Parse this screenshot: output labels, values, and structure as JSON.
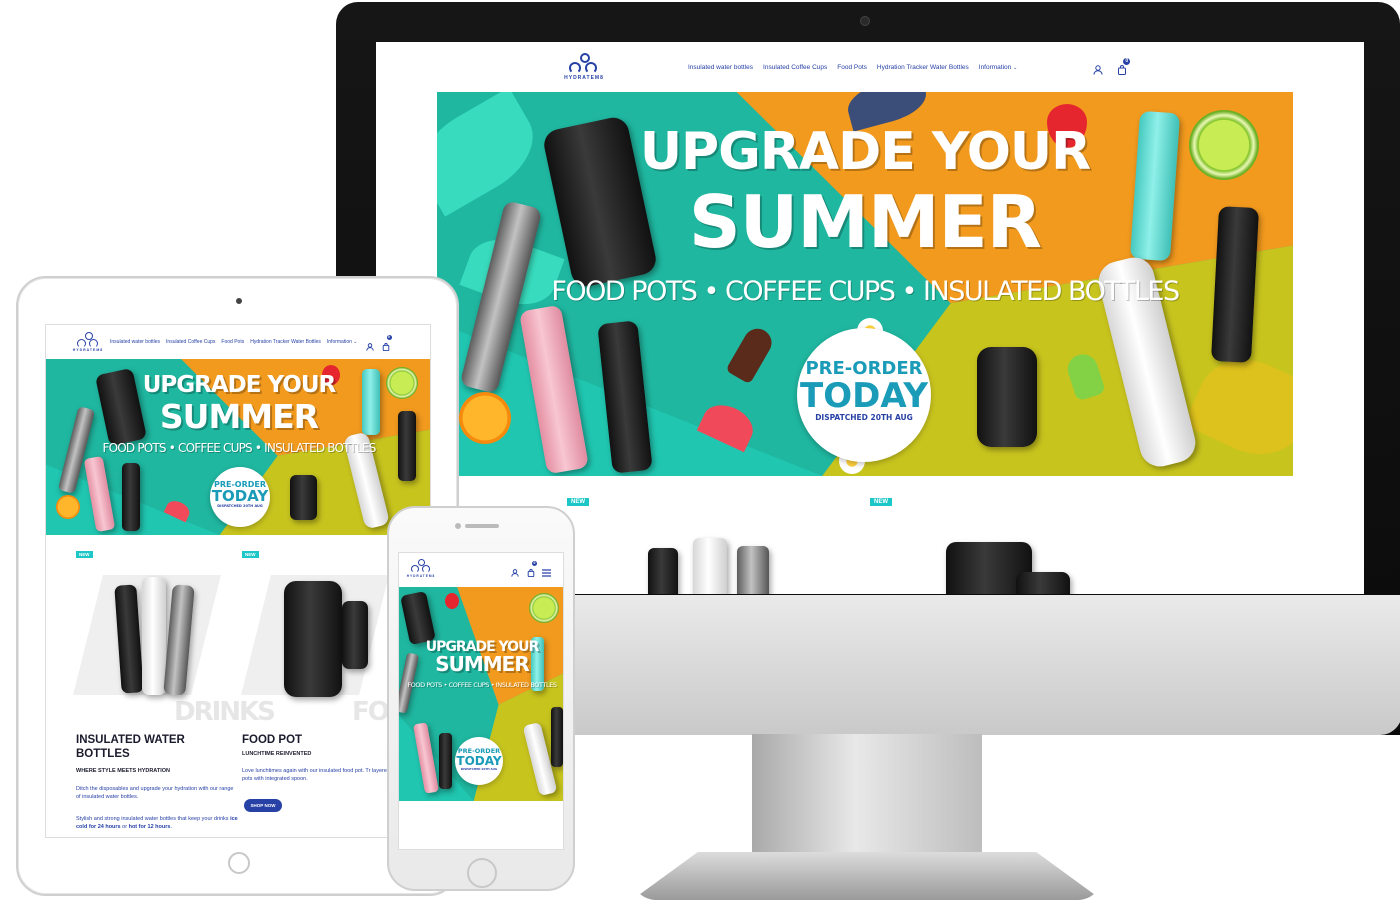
{
  "brand": {
    "logo_text": "HYDRATEM8",
    "primary_color": "#2741a6",
    "accent_color": "#1ec7c7"
  },
  "nav": {
    "items": [
      {
        "label": "Insulated water bottles"
      },
      {
        "label": "Insulated Coffee Cups"
      },
      {
        "label": "Food Pots"
      },
      {
        "label": "Hydration Tracker Water Bottles"
      },
      {
        "label": "Information"
      }
    ],
    "account_icon": "user-icon",
    "cart_icon": "cart-icon",
    "cart_count": "0",
    "menu_icon": "hamburger-icon"
  },
  "hero": {
    "title_line1": "UPGRADE YOUR",
    "title_line2": "SUMMER",
    "subtitle": "FOOD POTS • COFFEE CUPS • INSULATED BOTTLES",
    "badge_line1": "PRE-ORDER",
    "badge_line2": "TODAY",
    "badge_line3": "DISPATCHED 20TH AUG",
    "colors": {
      "teal": "#1fb7a0",
      "orange": "#f29a1e",
      "lime": "#c8c41e"
    }
  },
  "products": {
    "new_tag": "NEW",
    "drinks": {
      "title": "INSULATED WATER BOTTLES",
      "subtitle": "WHERE STYLE MEETS HYDRATION",
      "ghost_text": "DRINKS",
      "text_1": "Ditch the disposables and upgrade your hydration with our range of insulated water bottles.",
      "text_2_prefix": "Stylish and strong insulated water bottles that keep your drinks ",
      "text_2_cold": "ice cold for 24 hours",
      "text_2_mid": " or ",
      "text_2_hot": "hot for 12 hours",
      "text_2_suffix": "."
    },
    "food": {
      "title": "FOOD POT",
      "subtitle": "LUNCHTIME REINVENTED",
      "ghost_text": "FOOD",
      "text_1": "Love lunchtimes again with our insulated food pot. Tr layered 540ml food pots with integrated spoon.",
      "button_label": "SHOP NOW"
    }
  }
}
